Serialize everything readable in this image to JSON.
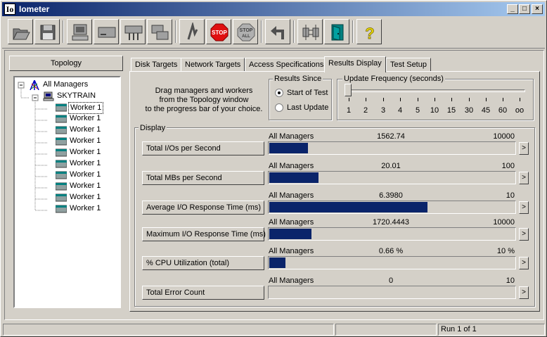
{
  "app": {
    "title": "Iometer",
    "icon_text": "Io"
  },
  "window_buttons": {
    "minimize": "_",
    "maximize": "□",
    "close": "×"
  },
  "toolbar": [
    {
      "name": "open-button",
      "icon": "folder-open-icon"
    },
    {
      "name": "save-button",
      "icon": "floppy-disk-icon"
    },
    {
      "name": "new-manager-button",
      "icon": "computer-icon"
    },
    {
      "name": "new-disk-worker-button",
      "icon": "disk-worker-icon"
    },
    {
      "name": "new-network-worker-button",
      "icon": "network-worker-icon"
    },
    {
      "name": "duplicate-worker-button",
      "icon": "duplicate-icon"
    },
    {
      "name": "start-button",
      "icon": "green-flag-icon"
    },
    {
      "name": "stop-button",
      "icon": "stop-sign-icon",
      "text": "STOP"
    },
    {
      "name": "stop-all-button",
      "icon": "stop-all-icon",
      "text": "STOP",
      "text2": "ALL"
    },
    {
      "name": "reset-workers-button",
      "icon": "undo-arrow-icon"
    },
    {
      "name": "disconnect-button",
      "icon": "disconnect-icon"
    },
    {
      "name": "exit-button",
      "icon": "exit-door-icon"
    },
    {
      "name": "about-button",
      "icon": "question-mark-icon",
      "text": "?"
    }
  ],
  "topology": {
    "header": "Topology",
    "root": "All Managers",
    "manager": "SKYTRAIN",
    "workers": [
      "Worker 1",
      "Worker 1",
      "Worker 1",
      "Worker 1",
      "Worker 1",
      "Worker 1",
      "Worker 1",
      "Worker 1",
      "Worker 1",
      "Worker 1"
    ]
  },
  "tabs": [
    "Disk Targets",
    "Network Targets",
    "Access Specifications",
    "Results Display",
    "Test Setup"
  ],
  "active_tab": "Results Display",
  "results": {
    "drag_text": [
      "Drag managers and workers",
      "from the Topology window",
      "to the progress bar of your choice."
    ],
    "results_since": {
      "label": "Results Since",
      "options": [
        "Start of Test",
        "Last Update"
      ],
      "selected": "Start of Test"
    },
    "update_frequency": {
      "label": "Update Frequency (seconds)",
      "ticks": [
        "1",
        "2",
        "3",
        "4",
        "5",
        "10",
        "15",
        "30",
        "45",
        "60",
        "oo"
      ],
      "value": "1"
    },
    "display_label": "Display",
    "rows": [
      {
        "button": "Total I/Os per Second",
        "source": "All Managers",
        "value": "1562.74",
        "max": "10000",
        "fraction": 0.15627
      },
      {
        "button": "Total MBs per Second",
        "source": "All Managers",
        "value": "20.01",
        "max": "100",
        "fraction": 0.2001
      },
      {
        "button": "Average I/O Response Time (ms)",
        "source": "All Managers",
        "value": "6.3980",
        "max": "10",
        "fraction": 0.6398
      },
      {
        "button": "Maximum I/O Response Time (ms)",
        "source": "All Managers",
        "value": "1720.4443",
        "max": "10000",
        "fraction": 0.172
      },
      {
        "button": "% CPU Utilization (total)",
        "source": "All Managers",
        "value": "0.66 %",
        "max": "10 %",
        "fraction": 0.066
      },
      {
        "button": "Total Error Count",
        "source": "All Managers",
        "value": "0",
        "max": "10",
        "fraction": 0
      }
    ],
    "arrow_label": ">"
  },
  "status": {
    "run": "Run 1 of 1"
  },
  "colors": {
    "bar_fill": "#0a246a",
    "title_start": "#0a246a",
    "title_end": "#a6caf0"
  }
}
